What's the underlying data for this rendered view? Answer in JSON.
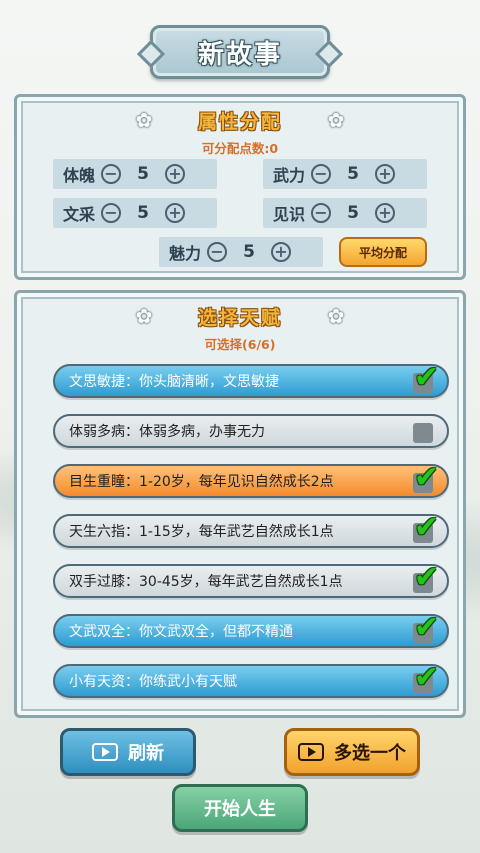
{
  "title": "新故事",
  "attributes": {
    "header": "属性分配",
    "points_label": "可分配点数:0",
    "items": [
      {
        "name": "体魄",
        "value": "5"
      },
      {
        "name": "武力",
        "value": "5"
      },
      {
        "name": "文采",
        "value": "5"
      },
      {
        "name": "见识",
        "value": "5"
      },
      {
        "name": "魅力",
        "value": "5"
      }
    ],
    "minus_glyph": "−",
    "plus_glyph": "+",
    "avg_button": "平均分配"
  },
  "talents": {
    "header": "选择天赋",
    "selectable_label": "可选择(6/6)",
    "items": [
      {
        "text": "文思敏捷：你头脑清晰，文思敏捷",
        "style": "blue",
        "checked": true
      },
      {
        "text": "体弱多病：体弱多病，办事无力",
        "style": "grey",
        "checked": false
      },
      {
        "text": "目生重瞳：1-20岁，每年见识自然成长2点",
        "style": "orange",
        "checked": true
      },
      {
        "text": "天生六指：1-15岁，每年武艺自然成长1点",
        "style": "grey",
        "checked": true
      },
      {
        "text": "双手过膝：30-45岁，每年武艺自然成长1点",
        "style": "grey",
        "checked": true
      },
      {
        "text": "文武双全：你文武双全，但都不精通",
        "style": "blue",
        "checked": true
      },
      {
        "text": "小有天资：你练武小有天赋",
        "style": "blue",
        "checked": true
      }
    ],
    "check_glyph": "✔",
    "flower_glyph": "✿"
  },
  "buttons": {
    "refresh": "刷新",
    "more": "多选一个",
    "start": "开始人生"
  },
  "colors": {
    "title_text": "#ffffff",
    "section_title": "#f3b53a",
    "sub_label": "#d4702b",
    "talent_blue": "#2e9cd2",
    "talent_orange": "#f48a2c",
    "talent_grey": "#cfd8dc",
    "check_green": "#28c21c"
  }
}
